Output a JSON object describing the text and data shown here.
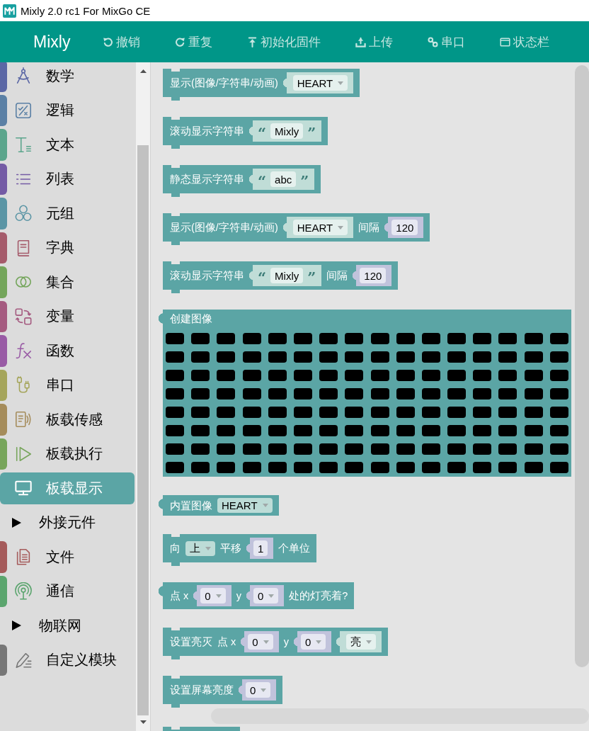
{
  "window": {
    "title": "Mixly 2.0 rc1 For MixGo CE"
  },
  "navbar": {
    "brand": "Mixly",
    "items": [
      {
        "label": "撤销"
      },
      {
        "label": "重复"
      },
      {
        "label": "初始化固件"
      },
      {
        "label": "上传"
      },
      {
        "label": "串口"
      },
      {
        "label": "状态栏"
      }
    ]
  },
  "sidebar": {
    "items": [
      {
        "kind": "category",
        "label": "数学",
        "color": "#5b67a5",
        "selected": false
      },
      {
        "kind": "category",
        "label": "逻辑",
        "color": "#5b80a5",
        "selected": false
      },
      {
        "kind": "category",
        "label": "文本",
        "color": "#5ba58c",
        "selected": false
      },
      {
        "kind": "category",
        "label": "列表",
        "color": "#745ba5",
        "selected": false
      },
      {
        "kind": "category",
        "label": "元组",
        "color": "#5b95a5",
        "selected": false
      },
      {
        "kind": "category",
        "label": "字典",
        "color": "#a55b6b",
        "selected": false
      },
      {
        "kind": "category",
        "label": "集合",
        "color": "#74a55b",
        "selected": false
      },
      {
        "kind": "category",
        "label": "变量",
        "color": "#a55b80",
        "selected": false
      },
      {
        "kind": "category",
        "label": "函数",
        "color": "#995ba5",
        "selected": false
      },
      {
        "kind": "category",
        "label": "串口",
        "color": "#a5a55b",
        "selected": false
      },
      {
        "kind": "category",
        "label": "板载传感",
        "color": "#a58c5b",
        "selected": false
      },
      {
        "kind": "category",
        "label": "板载执行",
        "color": "#77a55b",
        "selected": false
      },
      {
        "kind": "category",
        "label": "板载显示",
        "color": "#5ba5a5",
        "selected": true
      },
      {
        "kind": "folder",
        "label": "外接元件",
        "expanded": false,
        "selected": false
      },
      {
        "kind": "category",
        "label": "文件",
        "color": "#a55b5b",
        "selected": false
      },
      {
        "kind": "category",
        "label": "通信",
        "color": "#5ba56e",
        "selected": false
      },
      {
        "kind": "folder",
        "label": "物联网",
        "expanded": false,
        "selected": false
      },
      {
        "kind": "category",
        "label": "自定义模块",
        "color": "#777777",
        "selected": false
      }
    ]
  },
  "workspace": {
    "blocks": [
      {
        "kind": "statement",
        "parts": [
          {
            "kind": "label",
            "text": "显示(图像/字符串/动画)"
          },
          {
            "kind": "image_socket",
            "field": {
              "kind": "dropdown",
              "value": "HEART"
            }
          }
        ]
      },
      {
        "kind": "statement",
        "parts": [
          {
            "kind": "label",
            "text": "滚动显示字符串"
          },
          {
            "kind": "string_socket",
            "field": {
              "kind": "text",
              "open_quote": "“",
              "value": "Mixly",
              "close_quote": "”"
            }
          }
        ]
      },
      {
        "kind": "statement",
        "parts": [
          {
            "kind": "label",
            "text": "静态显示字符串"
          },
          {
            "kind": "string_socket",
            "field": {
              "kind": "text",
              "open_quote": "“",
              "value": "abc",
              "close_quote": "”"
            }
          }
        ]
      },
      {
        "kind": "statement",
        "parts": [
          {
            "kind": "label",
            "text": "显示(图像/字符串/动画)"
          },
          {
            "kind": "image_socket",
            "field": {
              "kind": "dropdown",
              "value": "HEART"
            }
          },
          {
            "kind": "label",
            "text": "间隔"
          },
          {
            "kind": "number_socket",
            "field": {
              "kind": "input",
              "value": "120"
            }
          }
        ]
      },
      {
        "kind": "statement",
        "parts": [
          {
            "kind": "label",
            "text": "滚动显示字符串"
          },
          {
            "kind": "string_socket",
            "field": {
              "kind": "text",
              "open_quote": "“",
              "value": "Mixly",
              "close_quote": "”"
            }
          },
          {
            "kind": "label",
            "text": "间隔"
          },
          {
            "kind": "number_socket",
            "field": {
              "kind": "input",
              "value": "120"
            }
          }
        ]
      },
      {
        "kind": "value",
        "parts": [
          {
            "kind": "label",
            "text": "创建图像"
          },
          {
            "kind": "pixels",
            "rows": [
              [
                false,
                false,
                false,
                false,
                false,
                false,
                false,
                false,
                false,
                false,
                false,
                false,
                false,
                false,
                false,
                false
              ],
              [
                false,
                false,
                false,
                false,
                false,
                false,
                false,
                false,
                false,
                false,
                false,
                false,
                false,
                false,
                false,
                false
              ],
              [
                false,
                false,
                false,
                false,
                false,
                false,
                false,
                false,
                false,
                false,
                false,
                false,
                false,
                false,
                false,
                false
              ],
              [
                false,
                false,
                false,
                false,
                false,
                false,
                false,
                false,
                false,
                false,
                false,
                false,
                false,
                false,
                false,
                false
              ],
              [
                false,
                false,
                false,
                false,
                false,
                false,
                false,
                false,
                false,
                false,
                false,
                false,
                false,
                false,
                false,
                false
              ],
              [
                false,
                false,
                false,
                false,
                false,
                false,
                false,
                false,
                false,
                false,
                false,
                false,
                false,
                false,
                false,
                false
              ],
              [
                false,
                false,
                false,
                false,
                false,
                false,
                false,
                false,
                false,
                false,
                false,
                false,
                false,
                false,
                false,
                false
              ],
              [
                false,
                false,
                false,
                false,
                false,
                false,
                false,
                false,
                false,
                false,
                false,
                false,
                false,
                false,
                false,
                false
              ]
            ]
          }
        ]
      },
      {
        "kind": "value",
        "parts": [
          {
            "kind": "label",
            "text": "内置图像"
          },
          {
            "kind": "dropdown",
            "value": "HEART"
          }
        ]
      },
      {
        "kind": "statement",
        "parts": [
          {
            "kind": "label",
            "text": "向"
          },
          {
            "kind": "dropdown",
            "value": "上"
          },
          {
            "kind": "label",
            "text": "平移"
          },
          {
            "kind": "number_socket",
            "field": {
              "kind": "input",
              "value": "1"
            }
          },
          {
            "kind": "label",
            "text": "个单位"
          }
        ]
      },
      {
        "kind": "value",
        "parts": [
          {
            "kind": "label",
            "text": "点 x"
          },
          {
            "kind": "number_socket",
            "field": {
              "kind": "dropdown",
              "value": "0"
            }
          },
          {
            "kind": "label",
            "text": "y"
          },
          {
            "kind": "number_socket",
            "field": {
              "kind": "dropdown",
              "value": "0"
            }
          },
          {
            "kind": "label",
            "text": "处的灯亮着?"
          }
        ]
      },
      {
        "kind": "statement",
        "parts": [
          {
            "kind": "label",
            "text": "设置亮灭"
          },
          {
            "kind": "label",
            "text": "点 x"
          },
          {
            "kind": "number_socket",
            "field": {
              "kind": "dropdown",
              "value": "0"
            }
          },
          {
            "kind": "label",
            "text": "y"
          },
          {
            "kind": "number_socket",
            "field": {
              "kind": "dropdown",
              "value": "0"
            }
          },
          {
            "kind": "image_socket",
            "field": {
              "kind": "dropdown",
              "value": "亮"
            }
          }
        ]
      },
      {
        "kind": "statement",
        "parts": [
          {
            "kind": "label",
            "text": "设置屏幕亮度"
          },
          {
            "kind": "number_socket",
            "field": {
              "kind": "dropdown",
              "value": "0"
            }
          }
        ]
      },
      {
        "kind": "statement"
      }
    ]
  }
}
